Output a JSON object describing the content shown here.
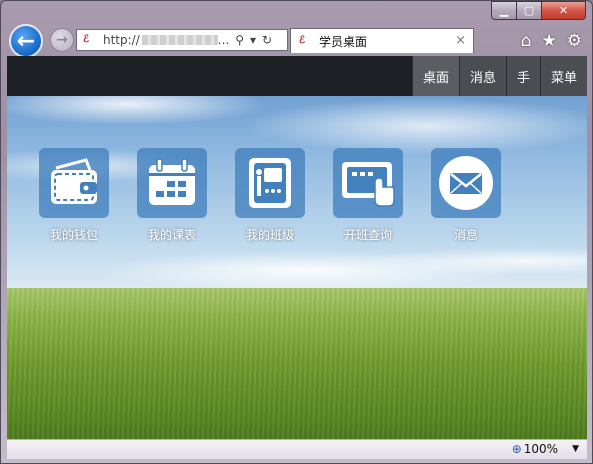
{
  "window": {
    "min_glyph": "▁",
    "max_glyph": "▢",
    "close_glyph": "✕"
  },
  "nav": {
    "back_glyph": "←",
    "forward_glyph": "→",
    "address": {
      "url_prefix": "http://",
      "url_ellipsis": "...",
      "search_glyph": "⚲",
      "dropdown_glyph": "▾",
      "refresh_glyph": "↻",
      "favicon_glyph": "ℰ"
    },
    "tab": {
      "title": "学员桌面",
      "close_glyph": "×"
    },
    "tools": {
      "home_glyph": "⌂",
      "favorites_glyph": "★",
      "settings_glyph": "⚙"
    }
  },
  "page": {
    "menu": [
      {
        "label": "桌面"
      },
      {
        "label": "消息"
      },
      {
        "label": "手"
      },
      {
        "label": "菜单"
      }
    ],
    "tiles": [
      {
        "label": "我的钱包",
        "icon": "wallet-icon"
      },
      {
        "label": "我的课表",
        "icon": "calendar-icon"
      },
      {
        "label": "我的班级",
        "icon": "class-icon"
      },
      {
        "label": "开班查询",
        "icon": "touch-screen-icon"
      },
      {
        "label": "消息",
        "icon": "envelope-icon"
      }
    ]
  },
  "status": {
    "zoom": "100%",
    "zoom_glyph": "⊕",
    "zoom_arrow": "▼"
  },
  "colors": {
    "page_header": "#1d2125",
    "tile_background": "#4280be",
    "menu_item": "#4a4e52"
  }
}
